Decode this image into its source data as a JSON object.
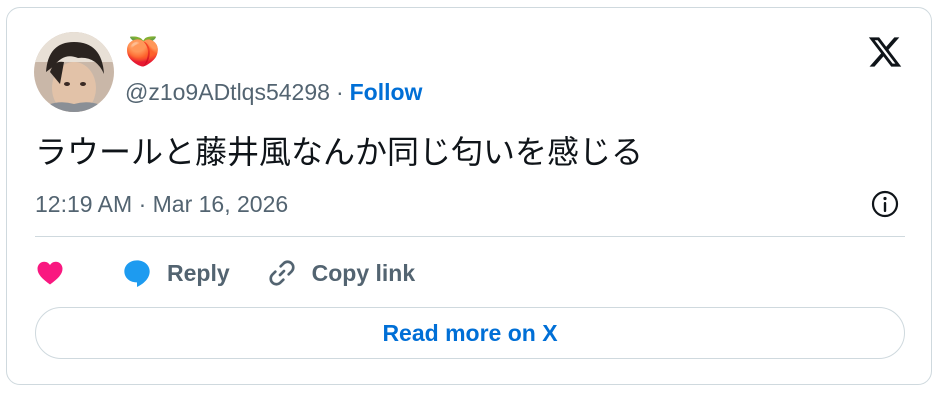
{
  "tweet": {
    "display_name": "🍑",
    "handle": "@z1o9ADtlqs54298",
    "separator": "·",
    "follow_label": "Follow",
    "text": "ラウールと藤井風なんか同じ匂いを感じる",
    "timestamp": "12:19 AM · Mar 16, 2026"
  },
  "actions": {
    "like_icon": "heart-icon",
    "reply_icon": "reply-bubble-icon",
    "reply_label": "Reply",
    "copy_icon": "link-icon",
    "copy_label": "Copy link"
  },
  "footer": {
    "read_more_label": "Read more on X"
  },
  "colors": {
    "link": "#006fd6",
    "muted": "#536471",
    "text": "#0f1419",
    "like": "#f91880",
    "reply": "#1d9bf0",
    "border": "#cfd9de"
  }
}
